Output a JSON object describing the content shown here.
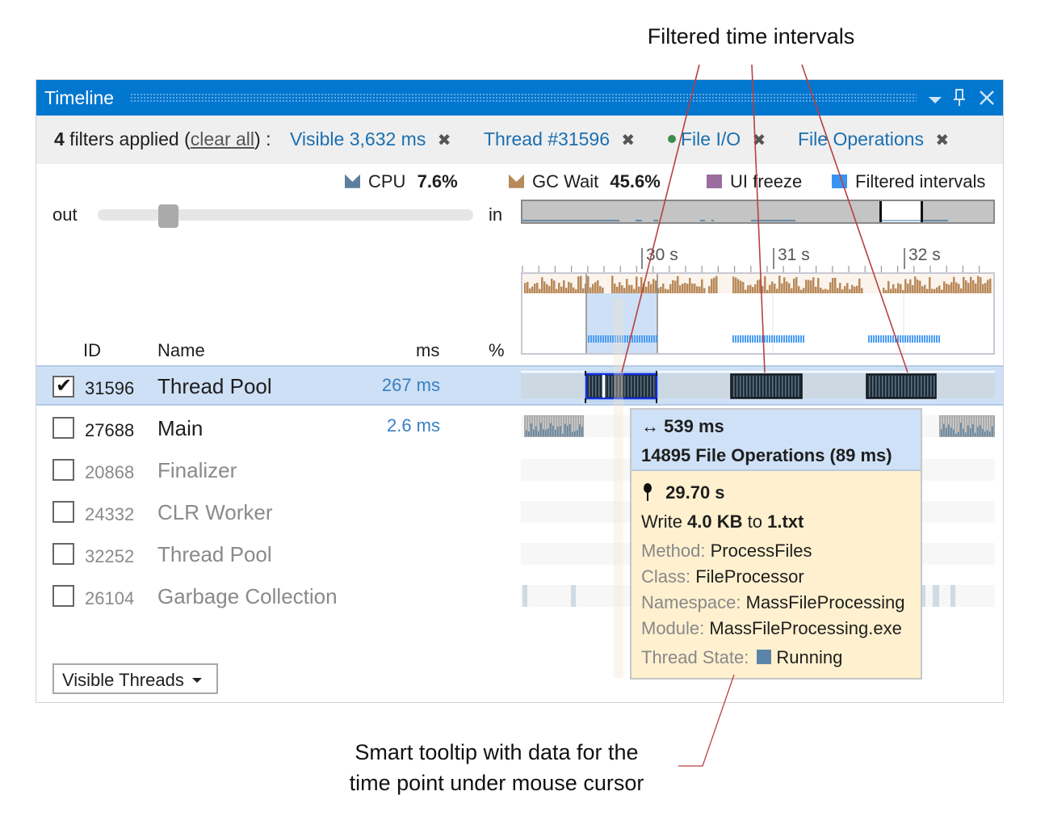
{
  "annotations": {
    "top": "Filtered time intervals",
    "bottom_line1": "Smart tooltip with data for the",
    "bottom_line2": "time point under mouse cursor"
  },
  "window": {
    "title": "Timeline",
    "icons": [
      "dropdown-arrow-icon",
      "pin-icon",
      "close-icon"
    ],
    "accent_color": "#0277d0"
  },
  "filters": {
    "count": "4",
    "applied_text": " filters applied (",
    "clear_all": "clear all",
    "suffix": ") :",
    "items": [
      {
        "label": "Visible 3,632 ms"
      },
      {
        "label": "Thread #31596"
      },
      {
        "label": "File I/O",
        "dot_color": "#3d8c4d"
      },
      {
        "label": "File Operations"
      }
    ],
    "remove_glyph": "✖"
  },
  "legend": {
    "cpu_label": "CPU",
    "cpu_value": "7.6%",
    "gc_label": "GC Wait",
    "gc_value": "45.6%",
    "ui_freeze": "UI freeze",
    "filtered": "Filtered intervals",
    "colors": {
      "cpu": "#5b7f9c",
      "gc": "#b8895a",
      "ui_freeze": "#9b6c9e",
      "filtered": "#3894f2"
    }
  },
  "zoom": {
    "out_label": "out",
    "in_label": "in",
    "level": 0.17
  },
  "ruler": {
    "labels": [
      "30 s",
      "31 s",
      "32 s"
    ]
  },
  "threads": {
    "headers": {
      "id": "ID",
      "name": "Name",
      "ms": "ms",
      "pct": "%"
    },
    "rows": [
      {
        "id": "31596",
        "name": "Thread Pool",
        "ms": "267 ms",
        "checked": true,
        "selected": true
      },
      {
        "id": "27688",
        "name": "Main",
        "ms": "2.6 ms",
        "checked": false
      },
      {
        "id": "20868",
        "name": "Finalizer",
        "ms": "",
        "checked": false
      },
      {
        "id": "24332",
        "name": "CLR Worker",
        "ms": "",
        "checked": false
      },
      {
        "id": "32252",
        "name": "Thread Pool",
        "ms": "",
        "checked": false
      },
      {
        "id": "26104",
        "name": "Garbage Collection",
        "ms": "",
        "checked": false
      }
    ],
    "visible_threads_button": "Visible Threads"
  },
  "tooltip": {
    "duration": "539 ms",
    "summary": "14895 File Operations (89 ms)",
    "time": "29.70 s",
    "op_verb": "Write ",
    "op_size": "4.0 KB",
    "op_to": " to ",
    "op_file": "1.txt",
    "fields": [
      {
        "key": "Method: ",
        "value": "ProcessFiles"
      },
      {
        "key": "Class: ",
        "value": "FileProcessor"
      },
      {
        "key": "Namespace: ",
        "value": "MassFileProcessing"
      },
      {
        "key": "Module: ",
        "value": "MassFileProcessing.exe"
      }
    ],
    "state_key": "Thread State: ",
    "state_value": "Running",
    "state_color": "#5a85a8"
  }
}
